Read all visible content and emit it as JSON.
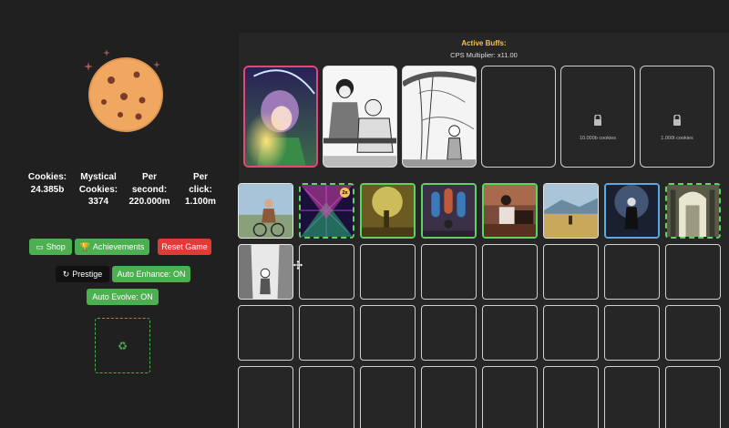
{
  "stats": {
    "cookies": {
      "label1": "Cookies:",
      "value": "24.385b"
    },
    "mystical": {
      "label1": "Mystical",
      "label2": "Cookies:",
      "value": "3374"
    },
    "per_second": {
      "label1": "Per",
      "label2": "second:",
      "value": "220.000m"
    },
    "per_click": {
      "label1": "Per",
      "label2": "click:",
      "value": "1.100m"
    }
  },
  "buttons": {
    "shop": "Shop",
    "achievements": "Achievements",
    "reset": "Reset Game",
    "prestige": "Prestige",
    "auto_enhance": "Auto Enhance: ON",
    "auto_evolve": "Auto Evolve: ON"
  },
  "icons": {
    "shop": "shop-icon",
    "achievements": "trophy-icon",
    "prestige": "refresh-icon",
    "recycle": "recycle-icon",
    "lock": "lock-icon"
  },
  "recycle_symbol": "♻",
  "buffs": {
    "title": "Active Buffs:",
    "multiplier": "CPS Multiplier: x11.00"
  },
  "buff_slots": [
    {
      "state": "image"
    },
    {
      "state": "image"
    },
    {
      "state": "image"
    },
    {
      "state": "empty"
    },
    {
      "state": "locked",
      "requirement": "10.000b cookies"
    },
    {
      "state": "locked",
      "requirement": "1.000t cookies"
    }
  ],
  "grid_badge": "2x",
  "colors": {
    "green": "#4caf50",
    "red": "#e53935",
    "gold": "#f2c14e",
    "background": "#202020"
  }
}
